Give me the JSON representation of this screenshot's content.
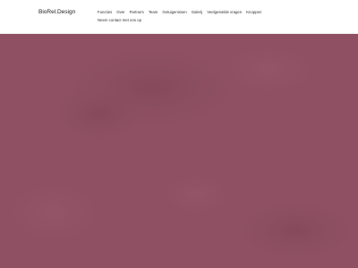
{
  "header": {
    "logo_text": "BioRel.Design",
    "nav": [
      "Functies",
      "Over",
      "Partners",
      "Team",
      "Getuigenissen",
      "Galerij",
      "Veelgestelde vragen",
      "Knoppen",
      "Neem contact met ons op"
    ]
  },
  "colors": {
    "hero_background": "#8e5062",
    "header_background": "#ffffff"
  }
}
